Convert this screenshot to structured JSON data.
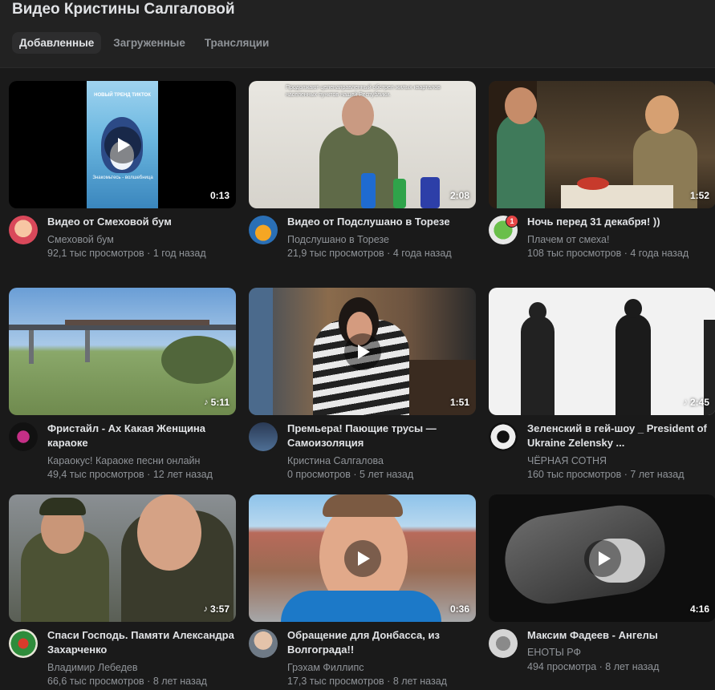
{
  "page": {
    "title": "Видео Кристины Салгаловой",
    "tabs": [
      {
        "label": "Добавленные",
        "active": true
      },
      {
        "label": "Загруженные",
        "active": false
      },
      {
        "label": "Трансляции",
        "active": false
      }
    ]
  },
  "videos": [
    {
      "title": "Видео от Смеховой бум",
      "channel": "Смеховой бум",
      "views": "92,1 тыс просмотров",
      "age": "1 год назад",
      "duration": "0:13",
      "music": false
    },
    {
      "title": "Видео от Подслушано в Торезе",
      "channel": "Подслушано в Торезе",
      "views": "21,9 тыс просмотров",
      "age": "4 года назад",
      "duration": "2:08",
      "music": false
    },
    {
      "title": "Ночь перед 31 декабря! ))",
      "channel": "Плачем от смеха!",
      "views": "108 тыс просмотров",
      "age": "4 года назад",
      "duration": "1:52",
      "music": false
    },
    {
      "title": "Фристайл - Ах Какая Женщина караоке",
      "channel": "Караокус! Караоке песни онлайн",
      "views": "49,4 тыс просмотров",
      "age": "12 лет назад",
      "duration": "5:11",
      "music": true
    },
    {
      "title": "Премьера! Пающие трусы — Самоизоляция",
      "channel": "Кристина Салгалова",
      "views": "0 просмотров",
      "age": "5 лет назад",
      "duration": "1:51",
      "music": false
    },
    {
      "title": "Зеленский в гей-шоу _ President of Ukraine Zelensky ...",
      "channel": "ЧЁРНАЯ СОТНЯ",
      "views": "160 тыс просмотров",
      "age": "7 лет назад",
      "duration": "2:45",
      "music": true
    },
    {
      "title": "Спаси Господь. Памяти Александра Захарченко",
      "channel": "Владимир Лебедев",
      "views": "66,6 тыс просмотров",
      "age": "8 лет назад",
      "duration": "3:57",
      "music": true
    },
    {
      "title": "Обращение для Донбасса, из Волгограда!!",
      "channel": "Грэхам Филлипс",
      "views": "17,3 тыс просмотров",
      "age": "8 лет назад",
      "duration": "0:36",
      "music": false
    },
    {
      "title": "Максим Фадеев - Ангелы",
      "channel": "ЕНОТЫ РФ",
      "views": "494 просмотра",
      "age": "8 лет назад",
      "duration": "4:16",
      "music": false
    }
  ],
  "thumb_overlays": {
    "v1_caption": "НОВЫЙ ТРЕНД ТИКТОК",
    "v1_sub": "Знакомьтесь - волшебница",
    "v2_caption": "Продолжают целенаправленный обстрел жилых кварталов населенных пунктов нашей Республики.",
    "avatar_badge": "1"
  },
  "separator": " · ",
  "colors": {
    "background": "#1a1a1a",
    "header": "#222222",
    "text_primary": "#e1e3e6",
    "text_secondary": "#909499",
    "badge": "#e64646"
  }
}
